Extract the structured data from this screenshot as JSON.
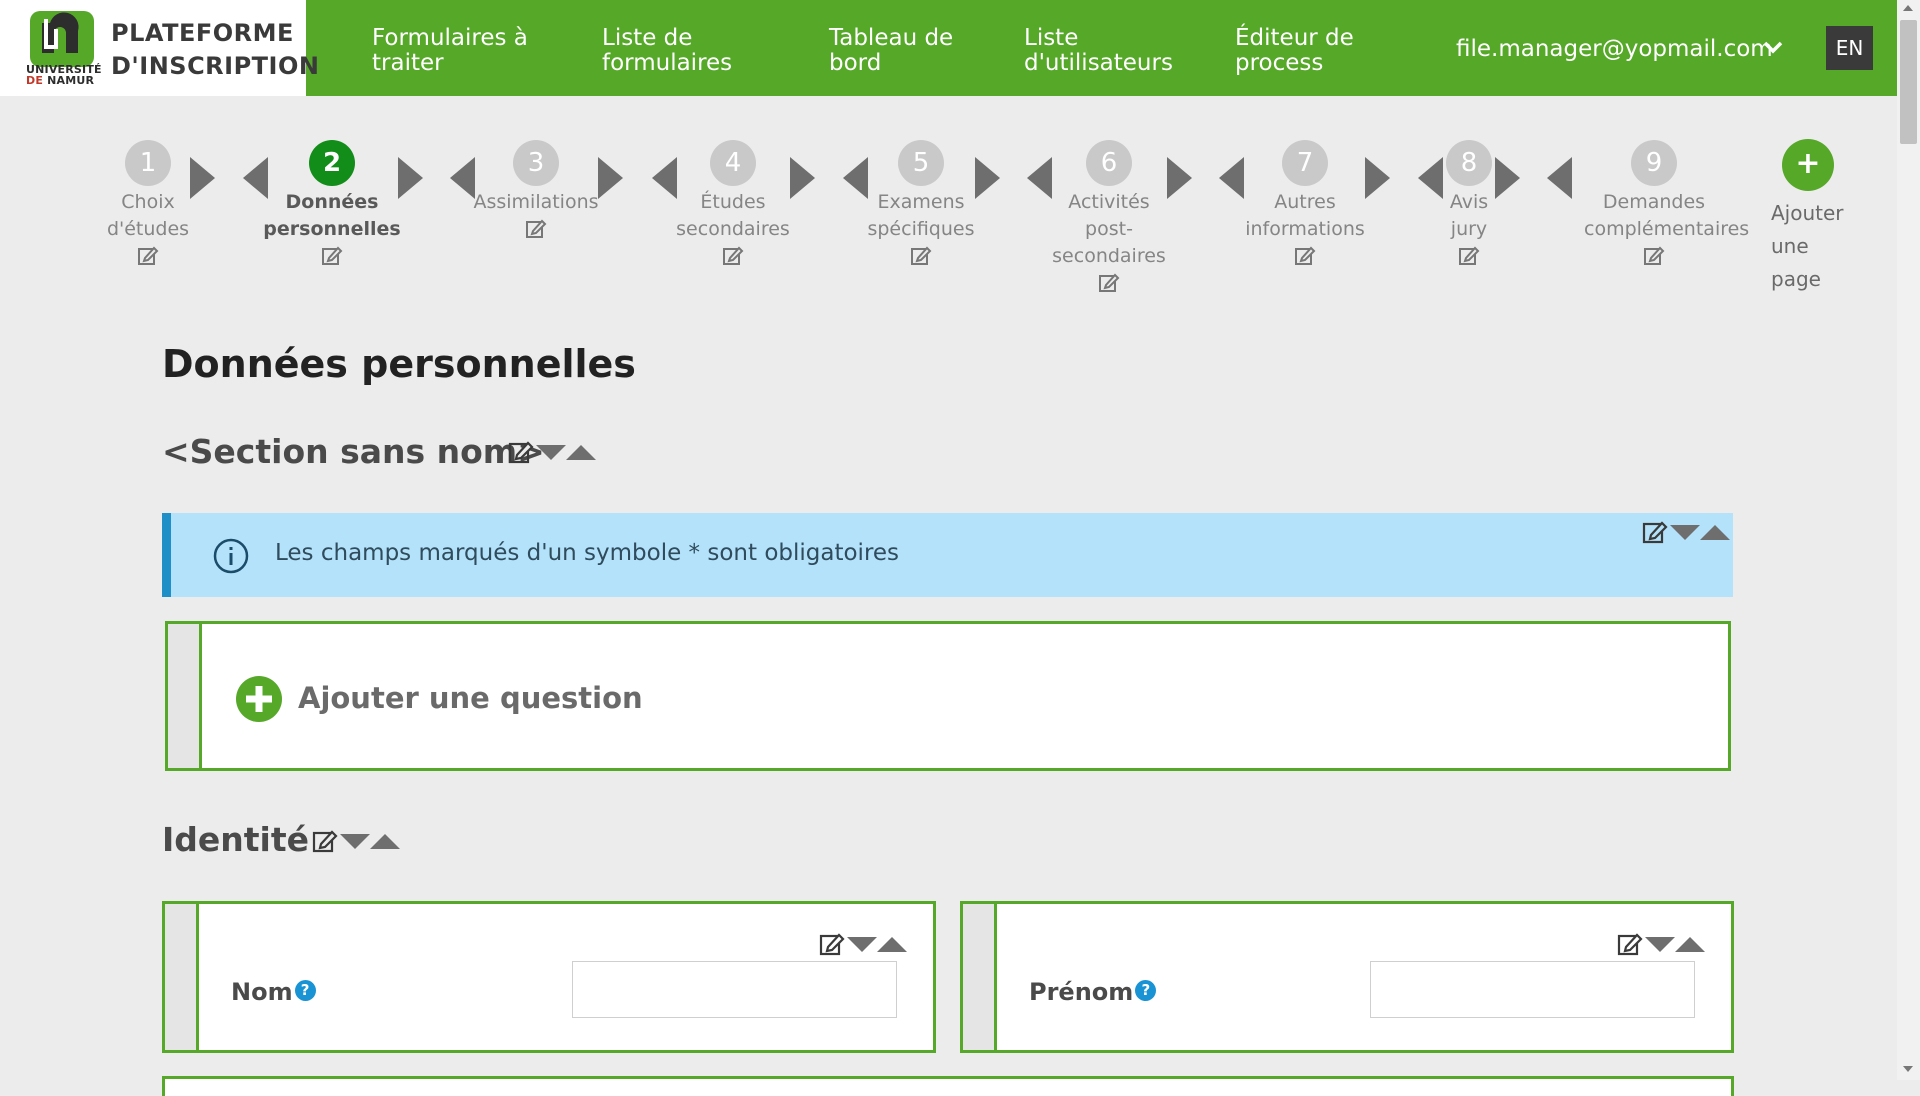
{
  "header": {
    "logo_title_line1": "PLATEFORME",
    "logo_title_line2": "D'INSCRIPTION",
    "logo_sub_line1": "UNIVERSITÉ",
    "logo_sub_de": "DE",
    "logo_sub_line2": "NAMUR",
    "nav": [
      {
        "line1": "Formulaires à",
        "line2": "traiter"
      },
      {
        "line1": "Liste de",
        "line2": "formulaires"
      },
      {
        "line1": "Tableau de",
        "line2": "bord"
      },
      {
        "line1": "Liste",
        "line2": "d'utilisateurs"
      },
      {
        "line1": "Éditeur de",
        "line2": "process"
      }
    ],
    "user_email": "file.manager@yopmail.com",
    "language": "EN",
    "color": "#56a829"
  },
  "steps": [
    {
      "number": "1",
      "line1": "Choix",
      "line2": "d'études",
      "line3": ""
    },
    {
      "number": "2",
      "line1": "Données",
      "line2": "personnelles",
      "line3": "",
      "active": true
    },
    {
      "number": "3",
      "line1": "Assimilations",
      "line2": "",
      "line3": ""
    },
    {
      "number": "4",
      "line1": "Études",
      "line2": "secondaires",
      "line3": ""
    },
    {
      "number": "5",
      "line1": "Examens",
      "line2": "spécifiques",
      "line3": ""
    },
    {
      "number": "6",
      "line1": "Activités",
      "line2": "post-",
      "line3": "secondaires"
    },
    {
      "number": "7",
      "line1": "Autres",
      "line2": "informations",
      "line3": ""
    },
    {
      "number": "8",
      "line1": "Avis",
      "line2": "jury",
      "line3": ""
    },
    {
      "number": "9",
      "line1": "Demandes",
      "line2": "complémentaires",
      "line3": ""
    }
  ],
  "add_page": {
    "icon": "+",
    "line1": "Ajouter",
    "line2": "une",
    "line3": "page"
  },
  "page_title": "Données personnelles",
  "sections": [
    {
      "title": "<Section sans nom>"
    },
    {
      "title": "Identité"
    }
  ],
  "info_message": "Les champs marqués d'un symbole * sont obligatoires",
  "add_question_label": "Ajouter une question",
  "fields": [
    {
      "label": "Nom",
      "help": "?",
      "value": ""
    },
    {
      "label": "Prénom",
      "help": "?",
      "value": ""
    }
  ]
}
